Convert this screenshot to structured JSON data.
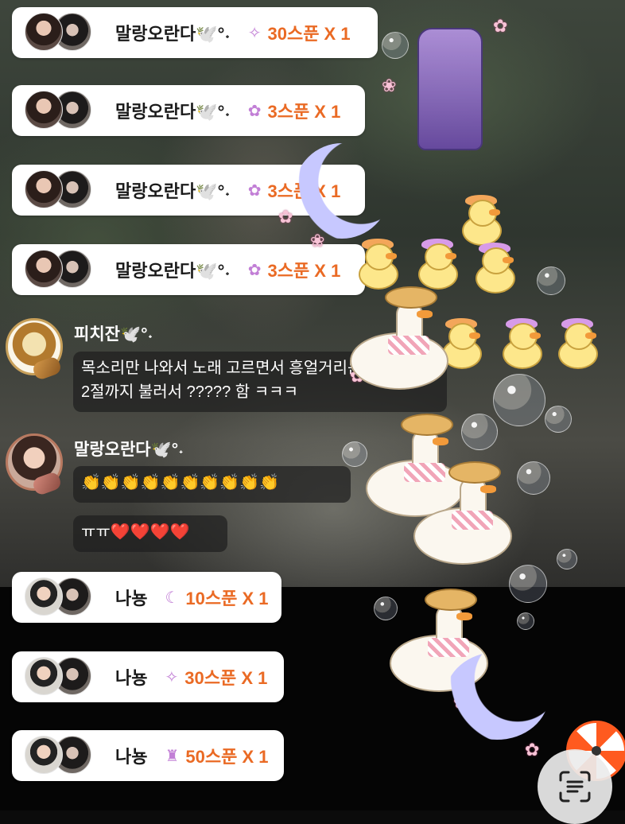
{
  "gift_feed": [
    {
      "sender": "말랑오란다🕊️°˖",
      "item_icon": "sparkle-gift-icon",
      "amount": "30스푼 X 1",
      "avatar": "pair-women"
    },
    {
      "sender": "말랑오란다🕊️°˖",
      "item_icon": "flower-gift-icon",
      "amount": "3스푼 X 1",
      "avatar": "pair-women"
    },
    {
      "sender": "말랑오란다🕊️°˖",
      "item_icon": "flower-gift-icon",
      "amount": "3스푼 X 1",
      "avatar": "pair-women"
    },
    {
      "sender": "말랑오란다🕊️°˖",
      "item_icon": "flower-gift-icon",
      "amount": "3스푼 X 1",
      "avatar": "pair-women"
    }
  ],
  "chat": [
    {
      "user": "피치잔🕊️°˖",
      "messages": [
        "목소리만 나와서 노래 고르면서 흥얼거리는 줄 알았는데",
        "2절까지 불러서 ????? 함 ㅋㅋㅋ"
      ]
    },
    {
      "user": "말랑오란다🕊️°˖",
      "messages": [
        "👏👏👏👏👏👏👏👏👏👏",
        "ㅠㅠ❤️❤️❤️❤️"
      ]
    }
  ],
  "gift_feed_bottom": [
    {
      "sender": "나뇽",
      "item_icon": "moon-gift-icon",
      "amount": "10스푼 X 1"
    },
    {
      "sender": "나뇽",
      "item_icon": "sparkle-gift-icon",
      "amount": "30스푼 X 1"
    },
    {
      "sender": "나뇽",
      "item_icon": "lantern-gift-icon",
      "amount": "50스푼 X 1"
    }
  ],
  "colors": {
    "gift_amount": "#ea6a24",
    "card_bg": "#ffffff",
    "chat_bubble": "rgba(30,30,30,0.72)"
  }
}
